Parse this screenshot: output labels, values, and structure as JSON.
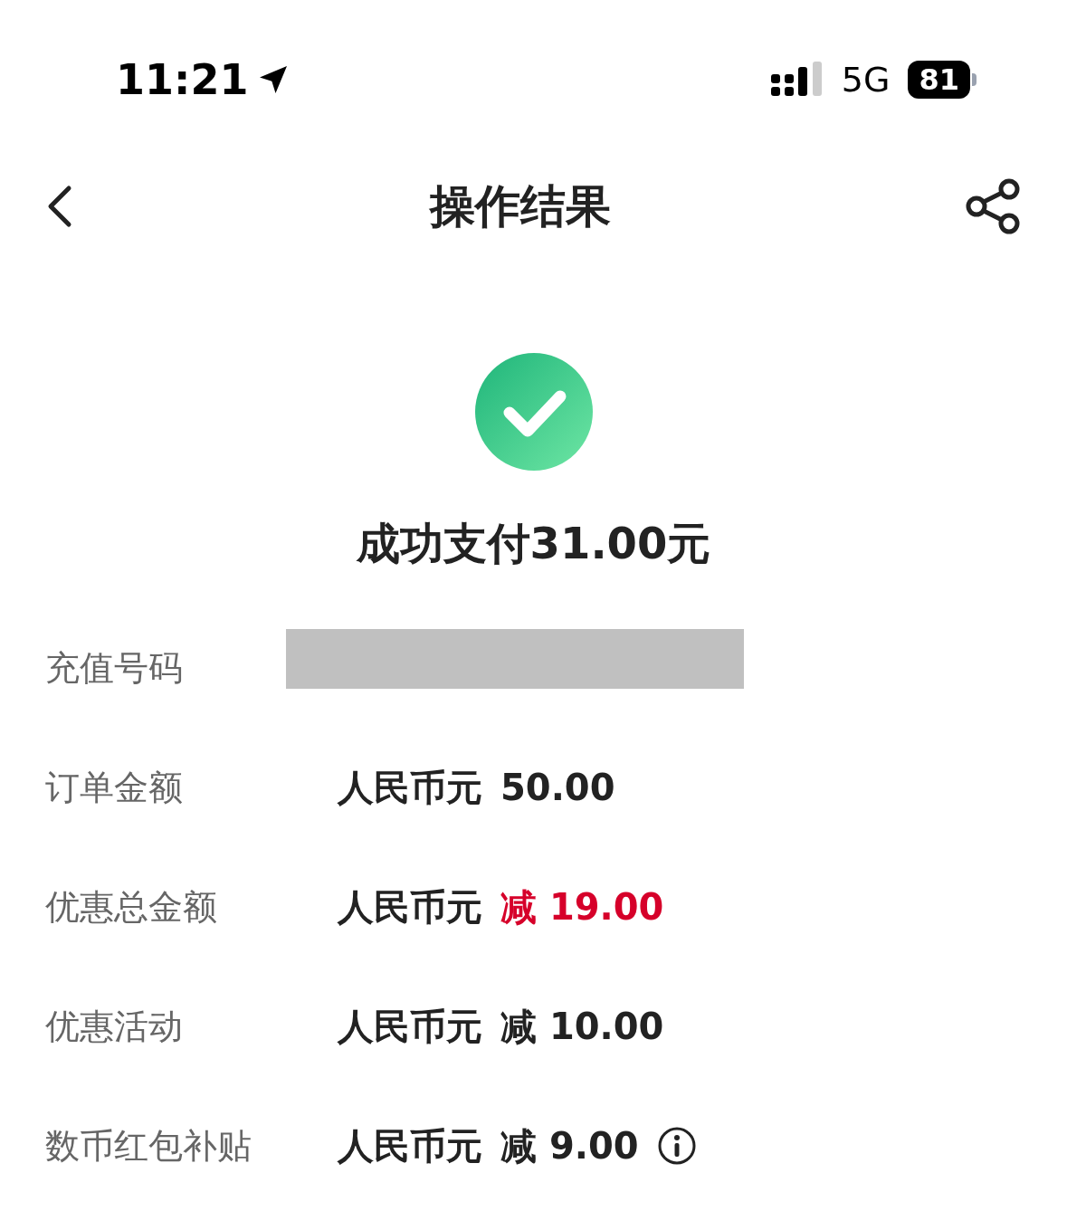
{
  "status_bar": {
    "time": "11:21",
    "network": "5G",
    "battery": "81"
  },
  "nav": {
    "title": "操作结果"
  },
  "result": {
    "message": "成功支付31.00元"
  },
  "rows": [
    {
      "kind": "redacted",
      "label": "充值号码"
    },
    {
      "kind": "amount",
      "label": "订单金额",
      "currency": "人民币元",
      "amount": "50.00",
      "highlighted": false
    },
    {
      "kind": "amount",
      "label": "优惠总金额",
      "currency": "人民币元",
      "amount": "减 19.00",
      "highlighted": true
    },
    {
      "kind": "amount",
      "label": "优惠活动",
      "currency": "人民币元",
      "amount": "减 10.00",
      "highlighted": false
    },
    {
      "kind": "amount_info",
      "label": "数币红包补贴",
      "currency": "人民币元",
      "amount": "减 9.00",
      "highlighted": false
    }
  ]
}
